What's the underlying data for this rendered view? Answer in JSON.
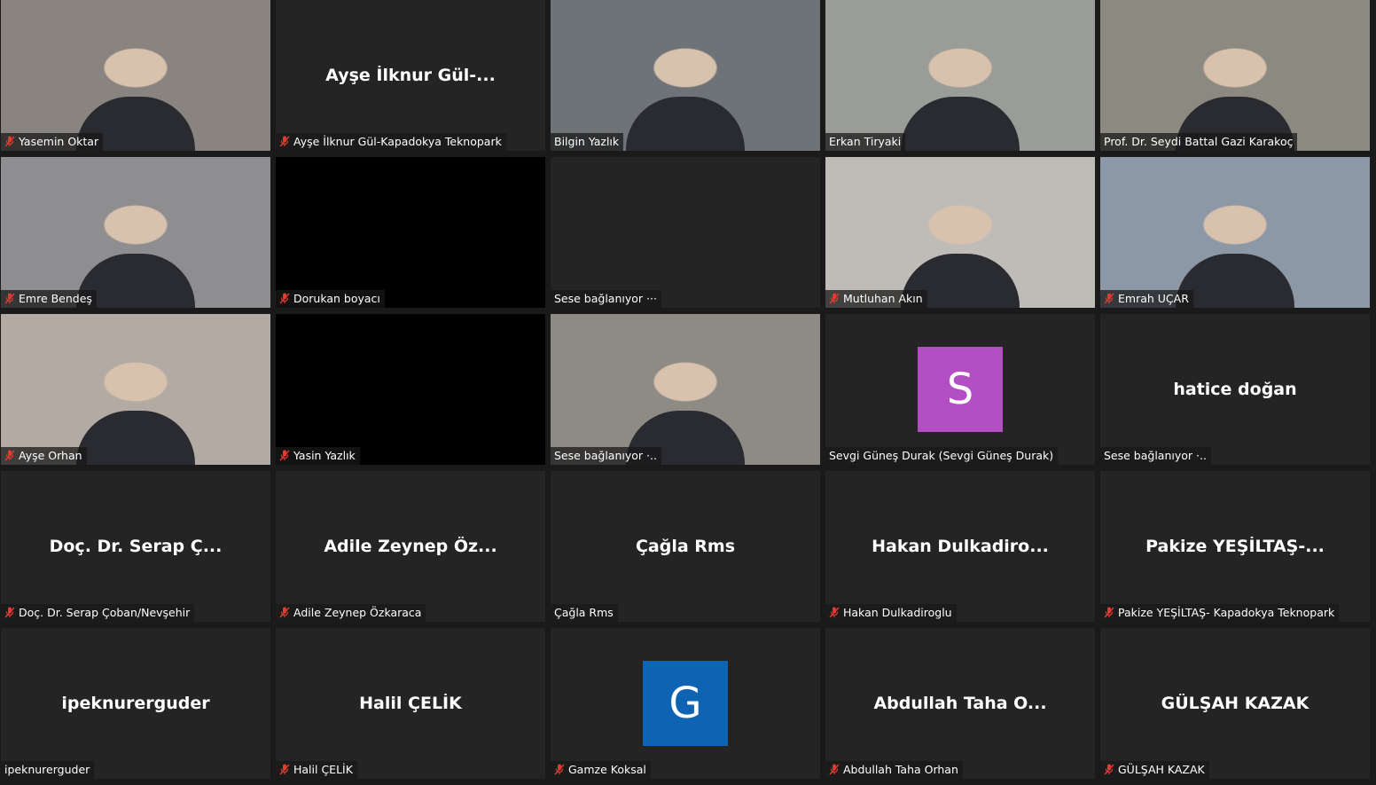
{
  "tiles": [
    {
      "label": "Yasemin Oktar",
      "muted": true,
      "mode": "video",
      "bg": "#8a8480"
    },
    {
      "label": "Ayşe İlknur Gül-Kapadokya Teknopark",
      "muted": true,
      "mode": "name",
      "bigname": "Ayşe İlknur Gül-..."
    },
    {
      "label": "Bilgin Yazlık",
      "muted": false,
      "mode": "video",
      "bg": "#6e7378",
      "speaking": true
    },
    {
      "label": "Erkan Tiryaki",
      "muted": false,
      "mode": "video",
      "bg": "#9a9c98"
    },
    {
      "label": "Prof. Dr. Seydi Battal Gazi Karakoç",
      "muted": false,
      "mode": "video",
      "bg": "#8c8a80"
    },
    {
      "label": "Emre Bendeş",
      "muted": true,
      "mode": "video",
      "bg": "#8e8d8f"
    },
    {
      "label": "Dorukan boyacı",
      "muted": true,
      "mode": "black"
    },
    {
      "label": "Sese bağlanıyor ···",
      "muted": false,
      "mode": "blank"
    },
    {
      "label": "Mutluhan Akın",
      "muted": true,
      "mode": "video",
      "bg": "#bfbcb8"
    },
    {
      "label": "Emrah UÇAR",
      "muted": true,
      "mode": "video",
      "bg": "#8d98a6"
    },
    {
      "label": "Ayşe Orhan",
      "muted": true,
      "mode": "video",
      "bg": "#b3aba3"
    },
    {
      "label": "Yasin Yazlık",
      "muted": true,
      "mode": "black"
    },
    {
      "label": "Sese bağlanıyor ·..",
      "muted": false,
      "mode": "video",
      "bg": "#8e8a84"
    },
    {
      "label": "Sevgi Güneş Durak (Sevgi Güneş Durak)",
      "muted": false,
      "mode": "avatar",
      "letter": "S",
      "avatarColor": "#b44ec4"
    },
    {
      "label": "Sese bağlanıyor ·..",
      "muted": false,
      "mode": "name",
      "bigname": "hatice doğan"
    },
    {
      "label": "Doç. Dr. Serap Çoban/Nevşehir",
      "muted": true,
      "mode": "name",
      "bigname": "Doç. Dr. Serap Ç..."
    },
    {
      "label": "Adile Zeynep Özkaraca",
      "muted": true,
      "mode": "name",
      "bigname": "Adile Zeynep Öz..."
    },
    {
      "label": "Çağla Rms",
      "muted": false,
      "mode": "name",
      "bigname": "Çağla Rms"
    },
    {
      "label": "Hakan Dulkadiroglu",
      "muted": true,
      "mode": "name",
      "bigname": "Hakan  Dulkadiro..."
    },
    {
      "label": "Pakize YEŞİLTAŞ- Kapadokya Teknopark",
      "muted": true,
      "mode": "name",
      "bigname": "Pakize  YEŞİLTAŞ-..."
    },
    {
      "label": "ipeknurerguder",
      "muted": false,
      "mode": "name",
      "bigname": "ipeknurerguder"
    },
    {
      "label": "Halil ÇELİK",
      "muted": true,
      "mode": "name",
      "bigname": "Halil ÇELİK"
    },
    {
      "label": "Gamze Koksal",
      "muted": true,
      "mode": "avatar",
      "letter": "G",
      "avatarColor": "#0e63b3"
    },
    {
      "label": "Abdullah Taha Orhan",
      "muted": true,
      "mode": "name",
      "bigname": "Abdullah Taha O..."
    },
    {
      "label": "GÜLŞAH KAZAK",
      "muted": true,
      "mode": "name",
      "bigname": "GÜLŞAH KAZAK"
    }
  ],
  "colors": {
    "tile": "#242424",
    "speakingBorder": "#e6e98c",
    "muteIcon": "#e03c31"
  }
}
